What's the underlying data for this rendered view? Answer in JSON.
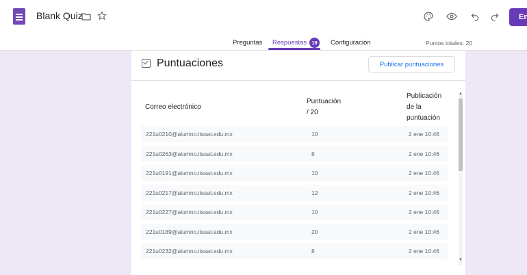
{
  "app": {
    "title": "Blank Quiz",
    "send_label": "En"
  },
  "tabs": [
    {
      "label": "Preguntas"
    },
    {
      "label": "Respuestas",
      "badge": "19"
    },
    {
      "label": "Configuración"
    }
  ],
  "points_total": "Puntos totales: 20",
  "card": {
    "title": "Puntuaciones",
    "publish_button": "Publicar puntuaciones"
  },
  "table": {
    "headers": {
      "email": "Correo electrónico",
      "score": [
        "Puntuación",
        "/ 20"
      ],
      "published": [
        "Publicación",
        "de la",
        "puntuación"
      ]
    },
    "rows": [
      {
        "email": "221u0210@alumno.itssat.edu.mx",
        "score": "10",
        "published": "2 ene 10:46"
      },
      {
        "email": "221u0263@alumno.itssat.edu.mx",
        "score": "8",
        "published": "2 ene 10:46"
      },
      {
        "email": "221u0191@alumno.itssat.edu.mx",
        "score": "10",
        "published": "2 ene 10:46"
      },
      {
        "email": "221u0217@alumno.itssat.edu.mx",
        "score": "12",
        "published": "2 ene 10:46"
      },
      {
        "email": "221u0227@alumno.itssat.edu.mx",
        "score": "10",
        "published": "2 ene 10:46"
      },
      {
        "email": "221u0189@alumno.itssat.edu.mx",
        "score": "20",
        "published": "2 ene 10:46"
      },
      {
        "email": "221u0232@alumno.itssat.edu.mx",
        "score": "8",
        "published": "2 ene 10:46"
      }
    ]
  },
  "icons": [
    "forms-app-icon",
    "folder-icon",
    "star-icon",
    "palette-icon",
    "preview-eye-icon",
    "undo-icon",
    "redo-icon",
    "checkbox-icon"
  ],
  "colors": {
    "accent": "#673ab7",
    "background": "#ede7f6",
    "link": "#1a73e8"
  }
}
